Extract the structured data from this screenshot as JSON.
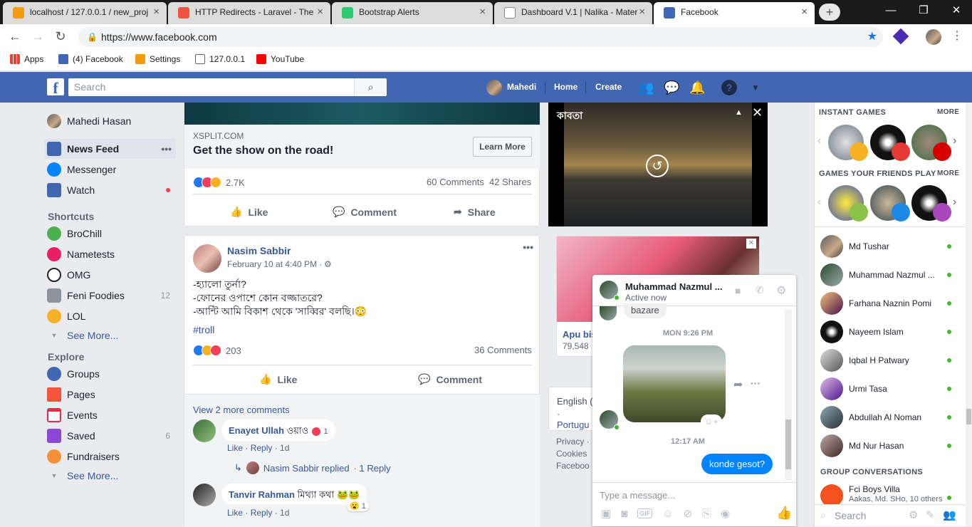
{
  "browser": {
    "tabs": [
      {
        "title": "localhost / 127.0.0.1 / new_proj",
        "color": "#f39c12"
      },
      {
        "title": "HTTP Redirects - Laravel - The",
        "color": "#f05340"
      },
      {
        "title": "Bootstrap Alerts",
        "color": "#2ecc71"
      },
      {
        "title": "Dashboard V.1 | Nalika - Mater",
        "color": "#bbbbbb"
      },
      {
        "title": "Facebook",
        "color": "#4267b2"
      }
    ],
    "url": "https://www.facebook.com",
    "bookmarks": [
      "Apps",
      "(4) Facebook",
      "Settings",
      "127.0.0.1",
      "YouTube"
    ]
  },
  "header": {
    "search_placeholder": "Search",
    "user": "Mahedi",
    "home": "Home",
    "create": "Create"
  },
  "left": {
    "profile": "Mahedi Hasan",
    "main": [
      {
        "label": "News Feed",
        "color": "#4267b2"
      },
      {
        "label": "Messenger",
        "color": "#0084ff"
      },
      {
        "label": "Watch",
        "color": "#4267b2"
      }
    ],
    "shortcuts_title": "Shortcuts",
    "shortcuts": [
      {
        "label": "BroChill",
        "color": "#4caf50",
        "count": ""
      },
      {
        "label": "Nametests",
        "color": "#e91e63",
        "count": ""
      },
      {
        "label": "OMG",
        "color": "#222222",
        "count": ""
      },
      {
        "label": "Feni Foodies",
        "color": "#8d949e",
        "count": "12"
      },
      {
        "label": "LOL",
        "color": "#f7b125",
        "count": ""
      }
    ],
    "see_more": "See More...",
    "explore_title": "Explore",
    "explore": [
      {
        "label": "Groups",
        "color": "#4267b2",
        "count": ""
      },
      {
        "label": "Pages",
        "color": "#f5533d",
        "count": ""
      },
      {
        "label": "Events",
        "color": "#f02849",
        "count": ""
      },
      {
        "label": "Saved",
        "color": "#8c48d2",
        "count": "6"
      },
      {
        "label": "Fundraisers",
        "color": "#f7923b",
        "count": ""
      }
    ]
  },
  "ad_post": {
    "domain": "XSPLIT.COM",
    "headline": "Get the show on the road!",
    "cta": "Learn More",
    "reactions": "2.7K",
    "comments": "60 Comments",
    "shares": "42 Shares",
    "like": "Like",
    "comment": "Comment",
    "share": "Share"
  },
  "post": {
    "author": "Nasim Sabbir",
    "time": "February 10 at 4:40 PM ·",
    "lines": [
      "-হ্যালো তুর্না?",
      "-ফোনের ওপাশে কোন বজ্জাতরে?",
      "-আন্টি আমি বিকাশ থেকে 'সাব্বির' বলছি।😳"
    ],
    "hashtag": "#troll",
    "reactions": "203",
    "comments": "36 Comments",
    "like": "Like",
    "comment": "Comment",
    "view_more": "View 2 more comments",
    "c1_author": "Enayet Ullah",
    "c1_text": "ওয়াও",
    "c1_react": "1",
    "reply_line": "Nasim Sabbir replied",
    "reply_count": "· 1 Reply",
    "c2_author": "Tanvir Rahman",
    "c2_text": "মিথ্যা কথা 🐸🐸",
    "c2_react": "1",
    "actions": [
      "Like",
      "Reply",
      "1d"
    ]
  },
  "video": {
    "title": "কাবতা"
  },
  "right_ad": {
    "name": "Apu bis",
    "count": "79,548"
  },
  "footer": {
    "lang": "English (",
    "lang2": "· Portugu",
    "privacy": "Privacy ·",
    "cookies": "Cookies",
    "fb": "Faceboo"
  },
  "games": {
    "instant_title": "INSTANT GAMES",
    "friends_title": "GAMES YOUR FRIENDS PLAY",
    "more": "MORE"
  },
  "contacts": [
    "Md Tushar",
    "Muhammad Nazmul ...",
    "Farhana Naznin Pomi",
    "Nayeem Islam",
    "Iqbal H Patwary",
    "Urmi Tasa",
    "Abdullah Al Noman",
    "Md Nur Hasan"
  ],
  "group_title": "GROUP CONVERSATIONS",
  "group_name": "Fci Boys Villa",
  "group_sub": "Aakas, Md. SHo, 10 others",
  "sidebar_search": "Search",
  "chat": {
    "name": "Muhammad Nazmul ...",
    "status": "Active now",
    "prev_msg": "bazare",
    "time1": "MON 9:26 PM",
    "time2": "12:17 AM",
    "my_msg": "konde gesot?",
    "input_placeholder": "Type a message..."
  }
}
